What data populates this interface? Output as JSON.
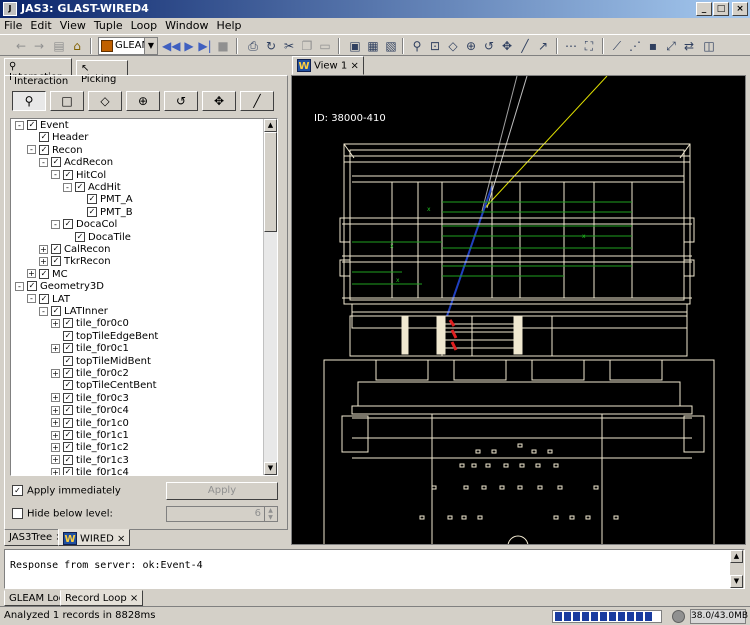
{
  "window": {
    "title": "JAS3: GLAST-WIRED4",
    "minimize_icon": "minimize-icon",
    "maximize_icon": "maximize-icon",
    "close_icon": "close-icon"
  },
  "menu": [
    "File",
    "Edit",
    "View",
    "Tuple",
    "Loop",
    "Window",
    "Help"
  ],
  "toolbar": {
    "combo_value": "GLEAM"
  },
  "left_panel": {
    "tabs": [
      "Interaction",
      "Picking"
    ],
    "group_label": "Interaction",
    "modes": [
      "zoom",
      "rectangle",
      "rotate",
      "sphere",
      "rotate-around",
      "pan",
      "ruler"
    ],
    "tree": [
      {
        "label": "Event",
        "level": 0,
        "exp": "-",
        "chk": true
      },
      {
        "label": "Header",
        "level": 1,
        "exp": "",
        "chk": true
      },
      {
        "label": "Recon",
        "level": 1,
        "exp": "-",
        "chk": true
      },
      {
        "label": "AcdRecon",
        "level": 2,
        "exp": "-",
        "chk": true
      },
      {
        "label": "HitCol",
        "level": 3,
        "exp": "-",
        "chk": true
      },
      {
        "label": "AcdHit",
        "level": 4,
        "exp": "-",
        "chk": true
      },
      {
        "label": "PMT_A",
        "level": 5,
        "exp": "",
        "chk": true
      },
      {
        "label": "PMT_B",
        "level": 5,
        "exp": "",
        "chk": true
      },
      {
        "label": "DocaCol",
        "level": 3,
        "exp": "-",
        "chk": true
      },
      {
        "label": "DocaTile",
        "level": 4,
        "exp": "",
        "chk": true
      },
      {
        "label": "CalRecon",
        "level": 2,
        "exp": "+",
        "chk": true
      },
      {
        "label": "TkrRecon",
        "level": 2,
        "exp": "+",
        "chk": true
      },
      {
        "label": "MC",
        "level": 1,
        "exp": "+",
        "chk": true
      },
      {
        "label": "Geometry3D",
        "level": 0,
        "exp": "-",
        "chk": true
      },
      {
        "label": "LAT",
        "level": 1,
        "exp": "-",
        "chk": true
      },
      {
        "label": "LATInner",
        "level": 2,
        "exp": "-",
        "chk": true
      },
      {
        "label": "tile_f0r0c0",
        "level": 3,
        "exp": "+",
        "chk": true
      },
      {
        "label": "topTileEdgeBent",
        "level": 3,
        "exp": "",
        "chk": true
      },
      {
        "label": "tile_f0r0c1",
        "level": 3,
        "exp": "+",
        "chk": true
      },
      {
        "label": "topTileMidBent",
        "level": 3,
        "exp": "",
        "chk": true
      },
      {
        "label": "tile_f0r0c2",
        "level": 3,
        "exp": "+",
        "chk": true
      },
      {
        "label": "topTileCentBent",
        "level": 3,
        "exp": "",
        "chk": true
      },
      {
        "label": "tile_f0r0c3",
        "level": 3,
        "exp": "+",
        "chk": true
      },
      {
        "label": "tile_f0r0c4",
        "level": 3,
        "exp": "+",
        "chk": true
      },
      {
        "label": "tile_f0r1c0",
        "level": 3,
        "exp": "+",
        "chk": true
      },
      {
        "label": "tile_f0r1c1",
        "level": 3,
        "exp": "+",
        "chk": true
      },
      {
        "label": "tile_f0r1c2",
        "level": 3,
        "exp": "+",
        "chk": true
      },
      {
        "label": "tile_f0r1c3",
        "level": 3,
        "exp": "+",
        "chk": true
      },
      {
        "label": "tile_f0r1c4",
        "level": 3,
        "exp": "+",
        "chk": true
      }
    ],
    "apply_immediately_label": "Apply immediately",
    "apply_immediately_checked": true,
    "apply_button": "Apply",
    "hide_below_label": "Hide below level:",
    "hide_below_checked": false,
    "level_value": "6",
    "bottom_tabs": [
      "JAS3Tree",
      "WIRED"
    ]
  },
  "view": {
    "tab_label": "View 1",
    "event_id": "ID: 38000-410"
  },
  "console": {
    "text": "Response from server: ok:Event-4",
    "tabs": [
      "GLEAM Log",
      "Record Loop"
    ]
  },
  "status": {
    "message": "Analyzed 1 records in 8828ms",
    "memory": "38.0/43.0MB",
    "progress_blocks": 11
  }
}
